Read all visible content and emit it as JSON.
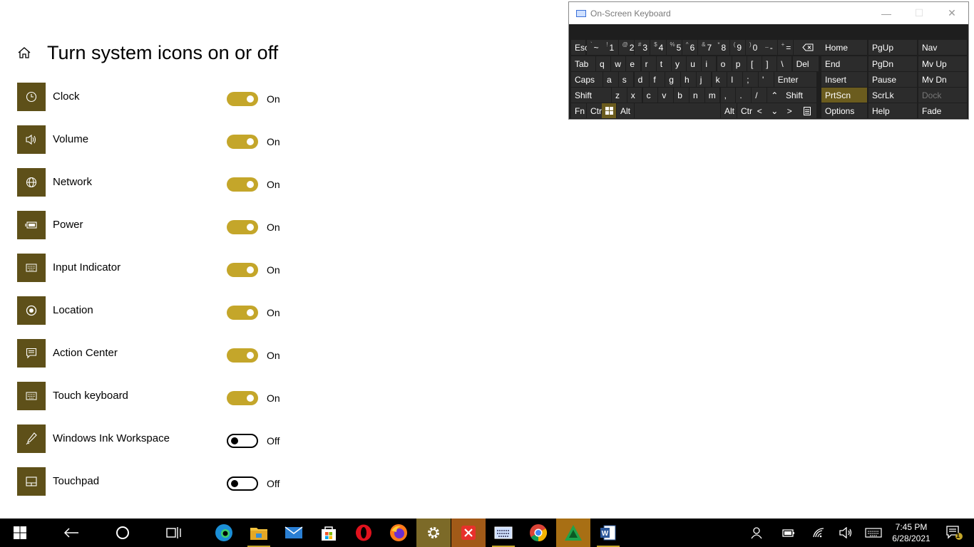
{
  "page": {
    "title": "Turn system icons on or off"
  },
  "items": [
    {
      "label": "Clock",
      "state": "On",
      "on": true,
      "icon": "clock-icon"
    },
    {
      "label": "Volume",
      "state": "On",
      "on": true,
      "icon": "volume-icon"
    },
    {
      "label": "Network",
      "state": "On",
      "on": true,
      "icon": "network-icon"
    },
    {
      "label": "Power",
      "state": "On",
      "on": true,
      "icon": "battery-icon"
    },
    {
      "label": "Input Indicator",
      "state": "On",
      "on": true,
      "icon": "keyboard-icon"
    },
    {
      "label": "Location",
      "state": "On",
      "on": true,
      "icon": "location-icon"
    },
    {
      "label": "Action Center",
      "state": "On",
      "on": true,
      "icon": "action-center-icon"
    },
    {
      "label": "Touch keyboard",
      "state": "On",
      "on": true,
      "icon": "touch-keyboard-icon"
    },
    {
      "label": "Windows Ink Workspace",
      "state": "Off",
      "on": false,
      "icon": "pen-icon"
    },
    {
      "label": "Touchpad",
      "state": "Off",
      "on": false,
      "icon": "touchpad-icon"
    }
  ],
  "osk": {
    "title": "On-Screen Keyboard",
    "row1": [
      "~",
      "1",
      "2",
      "3",
      "4",
      "5",
      "6",
      "7",
      "8",
      "9",
      "0",
      "-",
      "="
    ],
    "row1_sup": [
      "`",
      "!",
      "@",
      "#",
      "$",
      "%",
      "^",
      "&",
      "*",
      "(",
      ")",
      "_",
      "+"
    ],
    "row2": [
      "Tab",
      "q",
      "w",
      "e",
      "r",
      "t",
      "y",
      "u",
      "i",
      "o",
      "p",
      "[",
      "]",
      "\\",
      "Del"
    ],
    "row3": [
      "Caps",
      "a",
      "s",
      "d",
      "f",
      "g",
      "h",
      "j",
      "k",
      "l",
      ";",
      "'",
      "Enter"
    ],
    "row4": [
      "Shift",
      "z",
      "x",
      "c",
      "v",
      "b",
      "n",
      "m",
      ",",
      ".",
      "/",
      "Shift"
    ],
    "row5": [
      "Fn",
      "Ctr",
      "Alt",
      "Alt",
      "Ctr"
    ],
    "esc": "Esc",
    "nav": [
      [
        "Home",
        "PgUp",
        "Nav"
      ],
      [
        "End",
        "PgDn",
        "Mv Up"
      ],
      [
        "Insert",
        "Pause",
        "Mv Dn"
      ],
      [
        "PrtScn",
        "ScrLk",
        "Dock"
      ],
      [
        "Options",
        "Help",
        "Fade"
      ]
    ]
  },
  "taskbar": {
    "time": "7:45 PM",
    "date": "6/28/2021",
    "notification_count": "1"
  },
  "colors": {
    "accent": "#c4a62a",
    "tile": "#5e5019"
  }
}
